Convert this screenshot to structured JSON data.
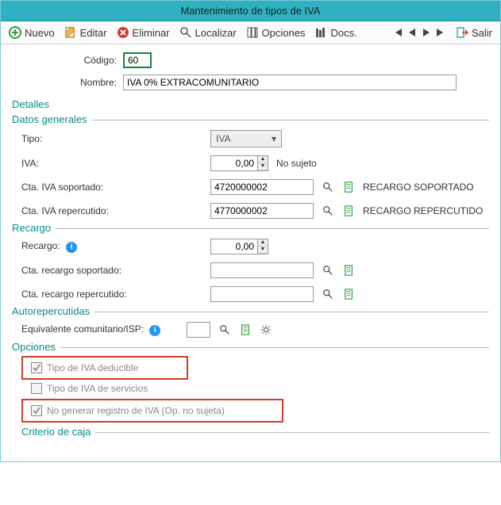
{
  "window": {
    "title": "Mantenimiento de tipos de IVA"
  },
  "toolbar": {
    "nuevo": "Nuevo",
    "editar": "Editar",
    "eliminar": "Eliminar",
    "localizar": "Localizar",
    "opciones": "Opciones",
    "docs": "Docs.",
    "salir": "Salir"
  },
  "header": {
    "codigo_label": "Código:",
    "codigo_value": "60",
    "nombre_label": "Nombre:",
    "nombre_value": "IVA 0% EXTRACOMUNITARIO"
  },
  "detalles": {
    "title": "Detalles",
    "generales": {
      "legend": "Datos generales",
      "tipo_label": "Tipo:",
      "tipo_value": "IVA",
      "iva_label": "IVA:",
      "iva_value": "0,00",
      "iva_status": "No sujeto",
      "cta_soportado_label": "Cta. IVA soportado:",
      "cta_soportado_value": "4720000002",
      "cta_soportado_rec": "RECARGO SOPORTADO",
      "cta_repercutido_label": "Cta. IVA repercutido:",
      "cta_repercutido_value": "4770000002",
      "cta_repercutido_rec": "RECARGO REPERCUTIDO"
    },
    "recargo": {
      "legend": "Recargo",
      "recargo_label": "Recargo:",
      "recargo_value": "0,00",
      "cta_soportado_label": "Cta. recargo soportado:",
      "cta_soportado_value": "",
      "cta_repercutido_label": "Cta. recargo repercutido:",
      "cta_repercutido_value": ""
    },
    "auto": {
      "legend": "Autorepercutidas",
      "eq_label": "Equivalente comunitario/ISP:",
      "eq_value": ""
    },
    "opciones": {
      "legend": "Opciones",
      "deducible": "Tipo de IVA deducible",
      "servicios": "Tipo de IVA de servicios",
      "no_generar": "No generar registro de IVA  (Op. no sujeta)"
    },
    "criterio": {
      "legend": "Criterio de caja"
    }
  }
}
